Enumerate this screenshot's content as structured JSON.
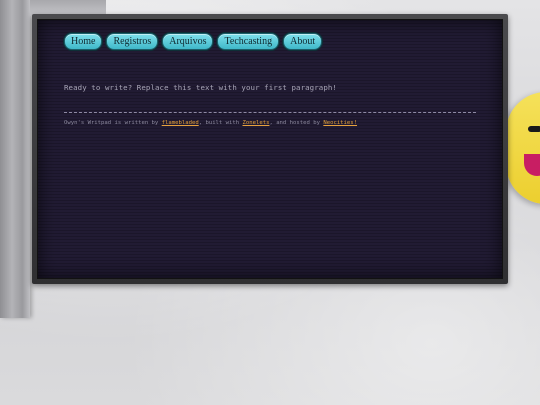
{
  "nav": {
    "items": [
      {
        "label": "Home"
      },
      {
        "label": "Registros"
      },
      {
        "label": "Arquivos"
      },
      {
        "label": "Techcasting"
      },
      {
        "label": "About"
      }
    ]
  },
  "main": {
    "paragraph": "Ready to write? Replace this text with your first paragraph!"
  },
  "footer": {
    "prefix": "Owyn's Writpad is written by ",
    "author_link": "flamebladed",
    "mid1": ", built with ",
    "tool_link": "Zonelets",
    "mid2": ", and hosted by ",
    "host_link": "Neocities!"
  },
  "colors": {
    "accent": "#3fb8c9",
    "link": "#e7a23c",
    "screen_bg": "#211b33"
  }
}
